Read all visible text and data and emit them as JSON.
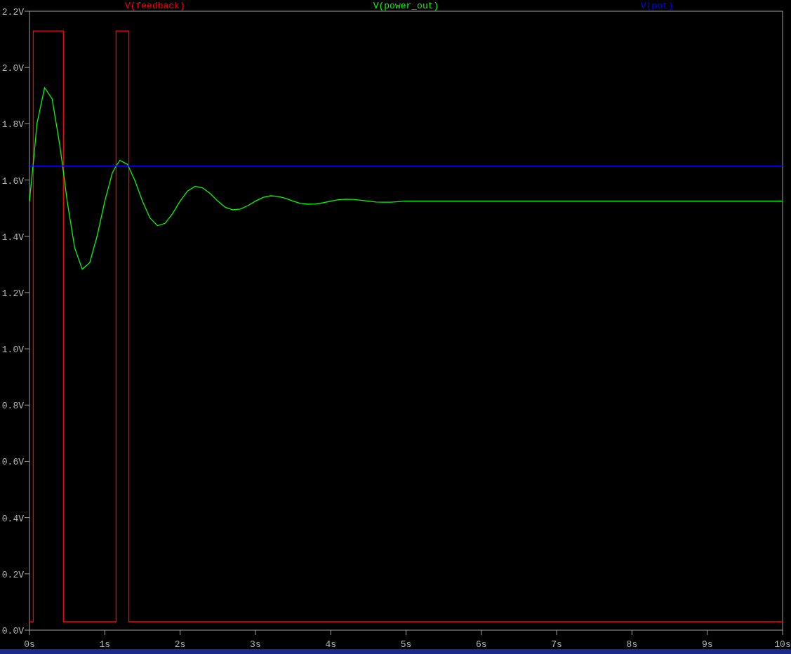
{
  "plot": {
    "chart_data": {
      "type": "line",
      "xlim": [
        0,
        10
      ],
      "ylim": [
        0,
        2.2
      ],
      "xticks": [
        {
          "value": 0,
          "label": "0s"
        },
        {
          "value": 1,
          "label": "1s"
        },
        {
          "value": 2,
          "label": "2s"
        },
        {
          "value": 3,
          "label": "3s"
        },
        {
          "value": 4,
          "label": "4s"
        },
        {
          "value": 5,
          "label": "5s"
        },
        {
          "value": 6,
          "label": "6s"
        },
        {
          "value": 7,
          "label": "7s"
        },
        {
          "value": 8,
          "label": "8s"
        },
        {
          "value": 9,
          "label": "9s"
        },
        {
          "value": 10,
          "label": "10s"
        }
      ],
      "yticks": [
        {
          "value": 0,
          "label": "0.0V"
        },
        {
          "value": 0.2,
          "label": "0.2V"
        },
        {
          "value": 0.4,
          "label": "0.4V"
        },
        {
          "value": 0.6,
          "label": "0.6V"
        },
        {
          "value": 0.8,
          "label": "0.8V"
        },
        {
          "value": 1.0,
          "label": "1.0V"
        },
        {
          "value": 1.2,
          "label": "1.2V"
        },
        {
          "value": 1.4,
          "label": "1.4V"
        },
        {
          "value": 1.6,
          "label": "1.6V"
        },
        {
          "value": 1.8,
          "label": "1.8V"
        },
        {
          "value": 2.0,
          "label": "2.0V"
        },
        {
          "value": 2.2,
          "label": "2.2V"
        }
      ],
      "x": [
        0,
        0.05,
        0.05,
        0.1,
        0.2,
        0.3,
        0.4,
        0.45,
        0.45,
        0.5,
        0.6,
        0.7,
        0.8,
        0.9,
        1.0,
        1.1,
        1.15,
        1.15,
        1.2,
        1.3,
        1.32,
        1.32,
        1.4,
        1.5,
        1.6,
        1.7,
        1.8,
        1.9,
        2.0,
        2.1,
        2.2,
        2.3,
        2.4,
        2.5,
        2.6,
        2.7,
        2.8,
        2.9,
        3.0,
        3.1,
        3.2,
        3.3,
        3.4,
        3.5,
        3.6,
        3.7,
        3.8,
        3.9,
        4.0,
        4.1,
        4.2,
        4.3,
        4.4,
        4.5,
        4.6,
        4.7,
        4.8,
        4.9,
        5.0,
        10
      ],
      "series": [
        {
          "name": "V(feedback)",
          "color": "#ff0000",
          "values": [
            0.03,
            0.03,
            2.13,
            2.13,
            2.13,
            2.13,
            2.13,
            2.13,
            0.03,
            0.03,
            0.03,
            0.03,
            0.03,
            0.03,
            0.03,
            0.03,
            0.03,
            2.13,
            2.13,
            2.13,
            2.13,
            0.03,
            0.03,
            0.03,
            0.03,
            0.03,
            0.03,
            0.03,
            0.03,
            0.03,
            0.03,
            0.03,
            0.03,
            0.03,
            0.03,
            0.03,
            0.03,
            0.03,
            0.03,
            0.03,
            0.03,
            0.03,
            0.03,
            0.03,
            0.03,
            0.03,
            0.03,
            0.03,
            0.03,
            0.03,
            0.03,
            0.03,
            0.03,
            0.03,
            0.03,
            0.03,
            0.03,
            0.03,
            0.03,
            0.03
          ]
        },
        {
          "name": "V(power_out)",
          "color": "#00ff00",
          "values": [
            1.525,
            1.66,
            1.66,
            1.801,
            1.928,
            1.889,
            1.728,
            1.63,
            1.63,
            1.525,
            1.359,
            1.283,
            1.306,
            1.403,
            1.525,
            1.625,
            1.65,
            1.65,
            1.67,
            1.656,
            1.645,
            1.645,
            1.598,
            1.525,
            1.465,
            1.438,
            1.446,
            1.481,
            1.525,
            1.561,
            1.578,
            1.572,
            1.552,
            1.525,
            1.503,
            1.494,
            1.497,
            1.509,
            1.525,
            1.538,
            1.544,
            1.542,
            1.535,
            1.525,
            1.517,
            1.514,
            1.515,
            1.519,
            1.525,
            1.53,
            1.532,
            1.531,
            1.528,
            1.525,
            1.522,
            1.521,
            1.521,
            1.523,
            1.525,
            1.525
          ]
        },
        {
          "name": "V(pot)",
          "color": "#0000ff",
          "values": [
            1.65,
            1.65,
            1.65,
            1.65,
            1.65,
            1.65,
            1.65,
            1.65,
            1.65,
            1.65,
            1.65,
            1.65,
            1.65,
            1.65,
            1.65,
            1.65,
            1.65,
            1.65,
            1.65,
            1.65,
            1.65,
            1.65,
            1.65,
            1.65,
            1.65,
            1.65,
            1.65,
            1.65,
            1.65,
            1.65,
            1.65,
            1.65,
            1.65,
            1.65,
            1.65,
            1.65,
            1.65,
            1.65,
            1.65,
            1.65,
            1.65,
            1.65,
            1.65,
            1.65,
            1.65,
            1.65,
            1.65,
            1.65,
            1.65,
            1.65,
            1.65,
            1.65,
            1.65,
            1.65,
            1.65,
            1.65,
            1.65,
            1.65,
            1.65,
            1.65
          ]
        }
      ]
    }
  }
}
